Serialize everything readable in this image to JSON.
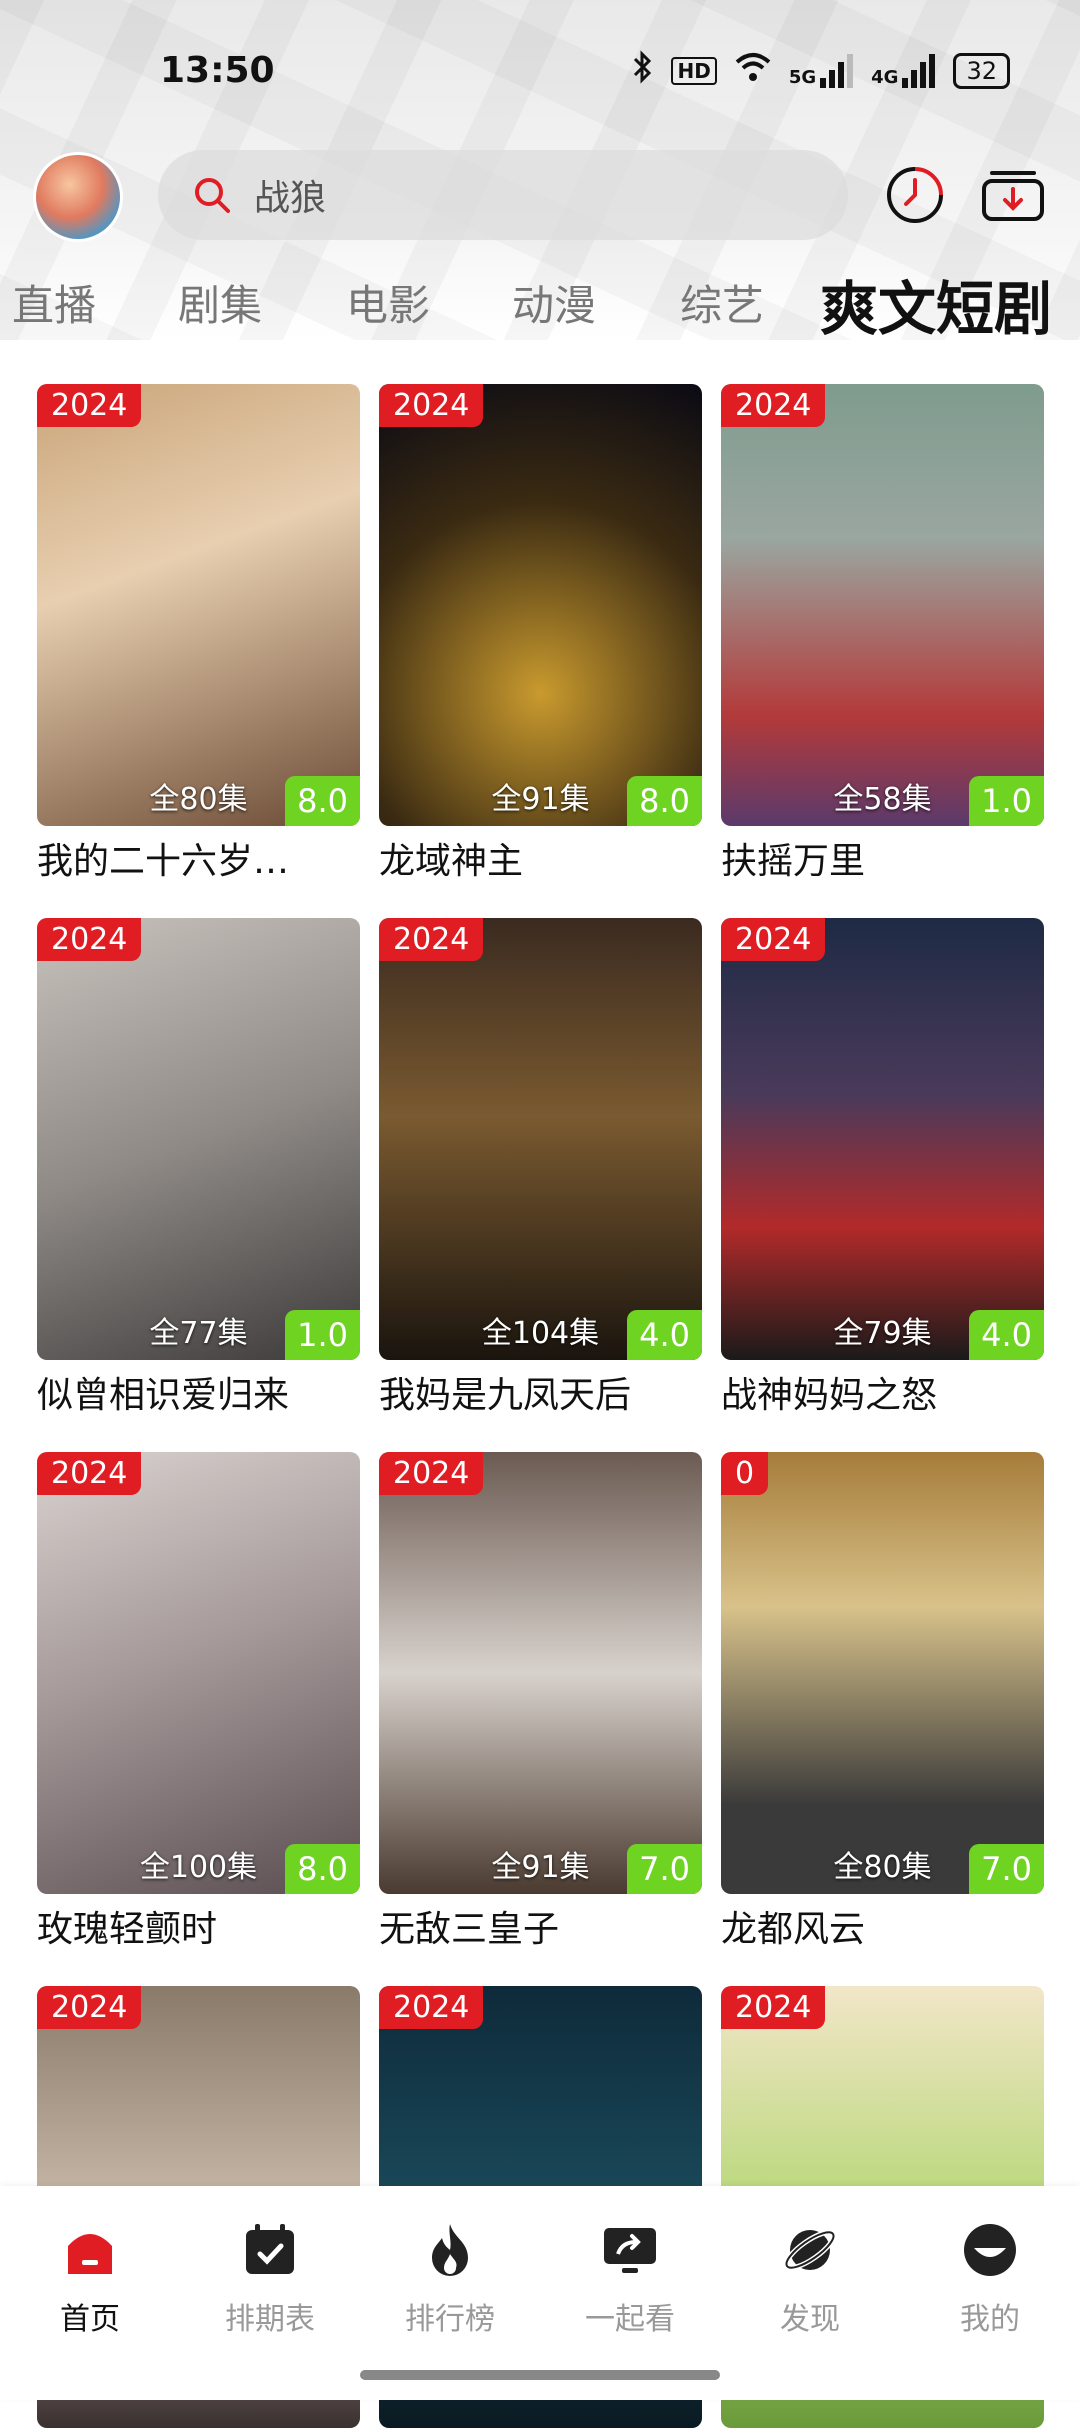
{
  "status_bar": {
    "time": "13:50",
    "network_hd": "HD",
    "signal_5g": "5G",
    "signal_4g": "4G",
    "battery": "32"
  },
  "header": {
    "search": {
      "value": "战狼"
    }
  },
  "tabs": [
    {
      "label": "直播"
    },
    {
      "label": "剧集"
    },
    {
      "label": "电影"
    },
    {
      "label": "动漫"
    },
    {
      "label": "综艺"
    },
    {
      "label": "爽文短剧",
      "active": true
    }
  ],
  "cards": [
    {
      "year": "2024",
      "episodes": "全80集",
      "score": "8.0",
      "title": "我的二十六岁…"
    },
    {
      "year": "2024",
      "episodes": "全91集",
      "score": "8.0",
      "title": "龙域神主"
    },
    {
      "year": "2024",
      "episodes": "全58集",
      "score": "1.0",
      "title": "扶摇万里"
    },
    {
      "year": "2024",
      "episodes": "全77集",
      "score": "1.0",
      "title": "似曾相识爱归来"
    },
    {
      "year": "2024",
      "episodes": "全104集",
      "score": "4.0",
      "title": "我妈是九凤天后"
    },
    {
      "year": "2024",
      "episodes": "全79集",
      "score": "4.0",
      "title": "战神妈妈之怒"
    },
    {
      "year": "2024",
      "episodes": "全100集",
      "score": "8.0",
      "title": "玫瑰轻颤时"
    },
    {
      "year": "2024",
      "episodes": "全91集",
      "score": "7.0",
      "title": "无敌三皇子"
    },
    {
      "year": "0",
      "episodes": "全80集",
      "score": "7.0",
      "title": "龙都风云"
    },
    {
      "year": "2024"
    },
    {
      "year": "2024"
    },
    {
      "year": "2024"
    }
  ],
  "bottom_nav": [
    {
      "label": "首页",
      "icon": "home-icon",
      "active": true
    },
    {
      "label": "排期表",
      "icon": "calendar-icon"
    },
    {
      "label": "排行榜",
      "icon": "flame-icon"
    },
    {
      "label": "一起看",
      "icon": "watch-together-icon"
    },
    {
      "label": "发现",
      "icon": "planet-icon"
    },
    {
      "label": "我的",
      "icon": "profile-icon"
    }
  ],
  "colors": {
    "accent": "#e11d24",
    "score_bg": "#6fd322"
  }
}
